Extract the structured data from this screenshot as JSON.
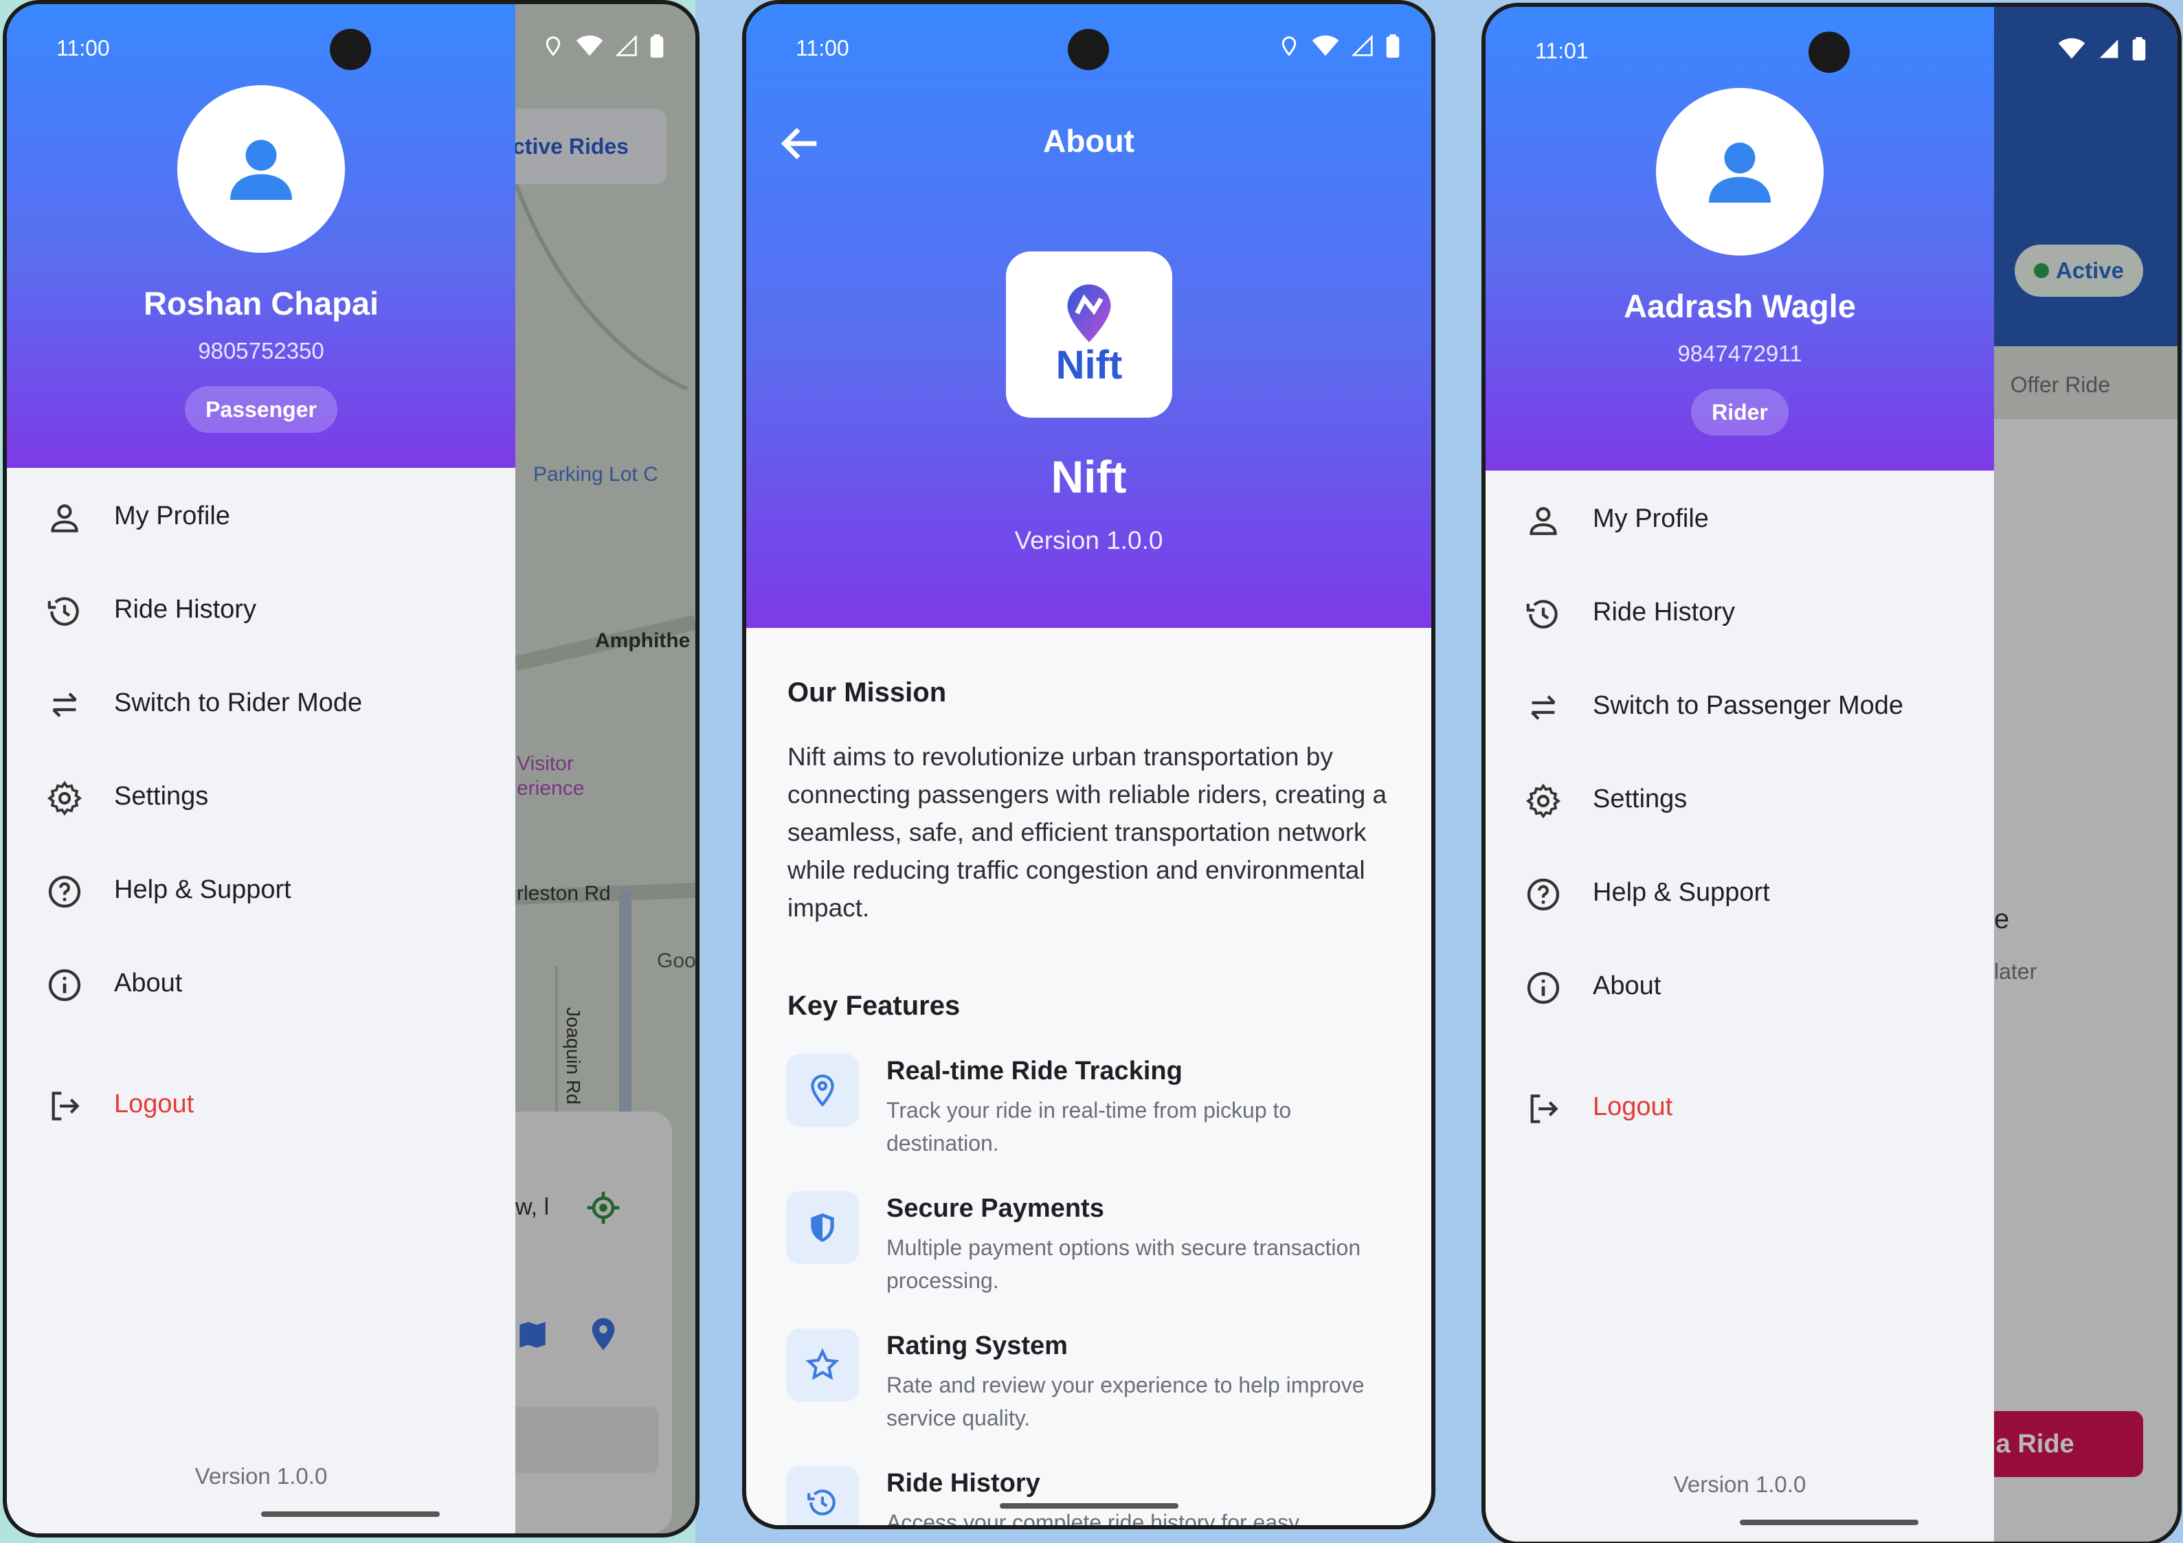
{
  "screens": [
    {
      "status_time": "11:00",
      "background": {
        "active_rides_button": "ctive Rides",
        "map_labels": {
          "parking": "Parking Lot C",
          "amphitheatre": "Amphithe",
          "visitor_line1": "Visitor",
          "visitor_line2": "erience",
          "charleston": "rleston Rd",
          "joaquin": "Joaquin Rd",
          "goo": "Goo",
          "search_fragment": "w, l"
        }
      },
      "drawer": {
        "user_name": "Roshan Chapai",
        "user_phone": "9805752350",
        "role_badge": "Passenger",
        "menu": [
          {
            "label": "My Profile",
            "icon": "person-icon"
          },
          {
            "label": "Ride History",
            "icon": "history-icon"
          },
          {
            "label": "Switch to Rider Mode",
            "icon": "swap-icon"
          },
          {
            "label": "Settings",
            "icon": "gear-icon"
          },
          {
            "label": "Help & Support",
            "icon": "help-icon"
          },
          {
            "label": "About",
            "icon": "info-icon"
          },
          {
            "label": "Logout",
            "icon": "logout-icon"
          }
        ],
        "version": "Version 1.0.0"
      }
    },
    {
      "status_time": "11:00",
      "header": {
        "title": "About",
        "logo_text": "Nift",
        "app_name": "Nift",
        "version": "Version 1.0.0"
      },
      "mission": {
        "title": "Our Mission",
        "text": "Nift aims to revolutionize urban transportation by connecting passengers with reliable riders, creating a seamless, safe, and efficient transportation network while reducing traffic congestion and environmental impact."
      },
      "features": {
        "title": "Key Features",
        "items": [
          {
            "title": "Real-time Ride Tracking",
            "desc": "Track your ride in real-time from pickup to destination.",
            "icon": "location-pin-icon"
          },
          {
            "title": "Secure Payments",
            "desc": "Multiple payment options with secure transaction processing.",
            "icon": "shield-icon"
          },
          {
            "title": "Rating System",
            "desc": "Rate and review your experience to help improve service quality.",
            "icon": "star-icon"
          },
          {
            "title": "Ride History",
            "desc": "Access your complete ride history for easy",
            "icon": "history-icon"
          }
        ]
      }
    },
    {
      "status_time": "11:01",
      "background": {
        "active_status": "Active",
        "offer_ride_tab": "Offer Ride",
        "fragment_e": "e",
        "fragment_later": "later",
        "offer_button": "r a Ride"
      },
      "drawer": {
        "user_name": "Aadrash Wagle",
        "user_phone": "9847472911",
        "role_badge": "Rider",
        "menu": [
          {
            "label": "My Profile",
            "icon": "person-icon"
          },
          {
            "label": "Ride History",
            "icon": "history-icon"
          },
          {
            "label": "Switch to Passenger Mode",
            "icon": "swap-icon"
          },
          {
            "label": "Settings",
            "icon": "gear-icon"
          },
          {
            "label": "Help & Support",
            "icon": "help-icon"
          },
          {
            "label": "About",
            "icon": "info-icon"
          },
          {
            "label": "Logout",
            "icon": "logout-icon"
          }
        ],
        "version": "Version 1.0.0"
      }
    }
  ],
  "colors": {
    "gradient_top": "#3a88ff",
    "gradient_bottom": "#7d3ae6",
    "logout_red": "#e53935",
    "accent_blue": "#2e67c8",
    "offer_button": "#d1124f"
  }
}
